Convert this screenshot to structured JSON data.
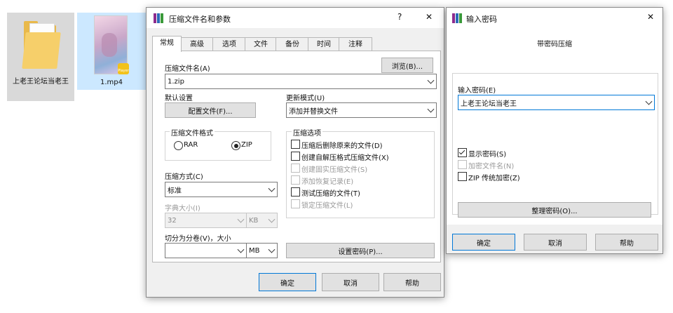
{
  "desktop": {
    "folder_label": "上老王论坛当老王",
    "video_label": "1.mp4",
    "video_badge": "Player"
  },
  "archive_dialog": {
    "title": "压缩文件名和参数",
    "help_glyph": "?",
    "close_glyph": "✕",
    "tabs": [
      "常规",
      "高级",
      "选项",
      "文件",
      "备份",
      "时间",
      "注释"
    ],
    "archive_name_label": "压缩文件名(A)",
    "archive_name_value": "1.zip",
    "browse_button": "浏览(B)...",
    "default_settings_label": "默认设置",
    "profile_button": "配置文件(F)...",
    "update_mode_label": "更新模式(U)",
    "update_mode_value": "添加并替换文件",
    "format_group_title": "压缩文件格式",
    "format_rar": "RAR",
    "format_zip": "ZIP",
    "options_group_title": "压缩选项",
    "options": [
      {
        "label": "压缩后删除原来的文件(D)",
        "checked": false,
        "enabled": true
      },
      {
        "label": "创建自解压格式压缩文件(X)",
        "checked": false,
        "enabled": true
      },
      {
        "label": "创建固实压缩文件(S)",
        "checked": false,
        "enabled": false
      },
      {
        "label": "添加恢复记录(E)",
        "checked": false,
        "enabled": false
      },
      {
        "label": "测试压缩的文件(T)",
        "checked": false,
        "enabled": true
      },
      {
        "label": "锁定压缩文件(L)",
        "checked": false,
        "enabled": false
      }
    ],
    "method_label": "压缩方式(C)",
    "method_value": "标准",
    "dict_label": "字典大小(I)",
    "dict_value": "32",
    "dict_unit": "KB",
    "split_label": "切分为分卷(V)，大小",
    "split_value": "",
    "split_unit": "MB",
    "set_password_button": "设置密码(P)...",
    "ok_button": "确定",
    "cancel_button": "取消",
    "help_button": "帮助"
  },
  "password_dialog": {
    "title": "输入密码",
    "close_glyph": "✕",
    "heading": "带密码压缩",
    "enter_password_label": "输入密码(E)",
    "password_value": "上老王论坛当老王",
    "show_password_label": "显示密码(S)",
    "show_password_checked": true,
    "encrypt_names_label": "加密文件名(N)",
    "encrypt_names_checked": false,
    "zip_legacy_label": "ZIP 传统加密(Z)",
    "zip_legacy_checked": false,
    "organize_button": "整理密码(O)...",
    "ok_button": "确定",
    "cancel_button": "取消",
    "help_button": "帮助"
  },
  "colors": {
    "folder": "#f6cf6a",
    "selection": "#cce8ff",
    "accent_border": "#0078d7",
    "rar_icon": [
      "#8e2b8e",
      "#2b6bb8",
      "#3a9a3a"
    ]
  }
}
